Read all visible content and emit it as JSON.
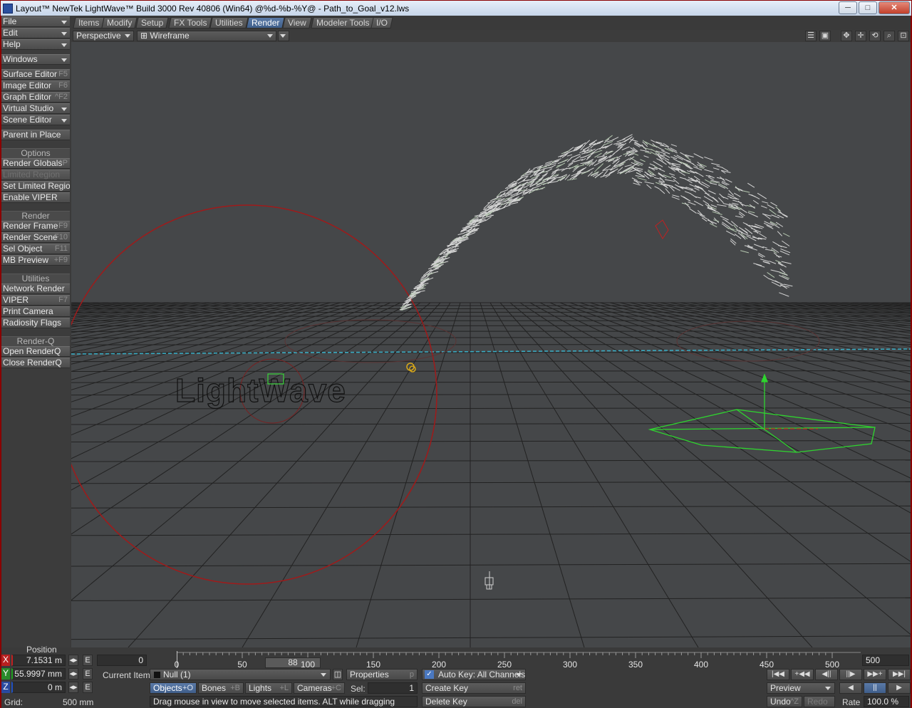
{
  "window": {
    "title": "Layout™ NewTek LightWave™  Build 3000 Rev 40806 (Win64) @%d-%b-%Y@   - Path_to_Goal_v12.lws",
    "minimize": "─",
    "maximize": "□",
    "close": "✕"
  },
  "left_toolbar": {
    "file": "File",
    "edit": "Edit",
    "help": "Help",
    "windows": "Windows",
    "surface_editor": "Surface Editor",
    "surface_editor_sc": "F5",
    "image_editor": "Image Editor",
    "image_editor_sc": "F6",
    "graph_editor": "Graph Editor",
    "graph_editor_sc": "^F2",
    "virtual_studio": "Virtual Studio",
    "scene_editor": "Scene Editor",
    "parent_in_place": "Parent in Place",
    "options_hdr": "Options",
    "render_globals": "Render Globals",
    "render_globals_sc": "^P",
    "limited_region": "Limited Region",
    "set_limited_region": "Set Limited Region",
    "enable_viper": "Enable VIPER",
    "render_hdr": "Render",
    "render_frame": "Render Frame",
    "render_frame_sc": "F9",
    "render_scene": "Render Scene",
    "render_scene_sc": "F10",
    "sel_object": "Sel Object",
    "sel_object_sc": "F11",
    "mb_preview": "MB Preview",
    "mb_preview_sc": "+F9",
    "utilities_hdr": "Utilities",
    "network_render": "Network Render",
    "viper": "VIPER",
    "viper_sc": "F7",
    "print_camera": "Print Camera",
    "radiosity_flags": "Radiosity Flags",
    "renderq_hdr": "Render-Q",
    "open_renderq": "Open RenderQ",
    "close_renderq": "Close RenderQ"
  },
  "tabs": {
    "items": "Items",
    "modify": "Modify",
    "setup": "Setup",
    "fx_tools": "FX Tools",
    "utilities": "Utilities",
    "render": "Render",
    "view": "View",
    "modeler_tools": "Modeler Tools",
    "io": "I/O"
  },
  "viewport_header": {
    "view_mode": "Perspective",
    "render_mode": "⊞ Wireframe"
  },
  "viewport": {
    "logo_text": "LightWave"
  },
  "bottom": {
    "position_label": "Position",
    "x_label": "X",
    "x_value": "7.1531 m",
    "y_label": "Y",
    "y_value": "55.9997 mm",
    "z_label": "Z",
    "z_value": "0 m",
    "grid_label": "Grid:",
    "grid_value": "500 mm",
    "e_label": "E",
    "frame_start": "0",
    "frame_end": "500",
    "current_frame": "88",
    "timeline_ticks": [
      "0",
      "50",
      "100",
      "150",
      "200",
      "250",
      "300",
      "350",
      "400",
      "450",
      "500"
    ],
    "current_item_label": "Current Item",
    "current_item_value": "Null (1)",
    "properties": "Properties",
    "properties_sc": "p",
    "auto_key": "Auto Key: All Channels",
    "objects": "Objects",
    "objects_sc": "+O",
    "bones": "Bones",
    "bones_sc": "+B",
    "lights": "Lights",
    "lights_sc": "+L",
    "cameras": "Cameras",
    "cameras_sc": "+C",
    "sel_label": "Sel:",
    "sel_value": "1",
    "create_key": "Create Key",
    "create_key_sc": "ret",
    "delete_key": "Delete Key",
    "delete_key_sc": "del",
    "status_text": "Drag mouse in view to move selected items. ALT while dragging snaps to ite",
    "preview": "Preview",
    "undo": "Undo",
    "undo_sc": "^Z",
    "redo": "Redo",
    "rate_label": "Rate",
    "rate_value": "100.0 %",
    "transport_top": [
      "|◀◀",
      "+◀◀",
      "◀||",
      "||▶",
      "▶▶+",
      "▶▶|"
    ],
    "transport_bottom": [
      "◀",
      "||",
      "▶"
    ]
  }
}
